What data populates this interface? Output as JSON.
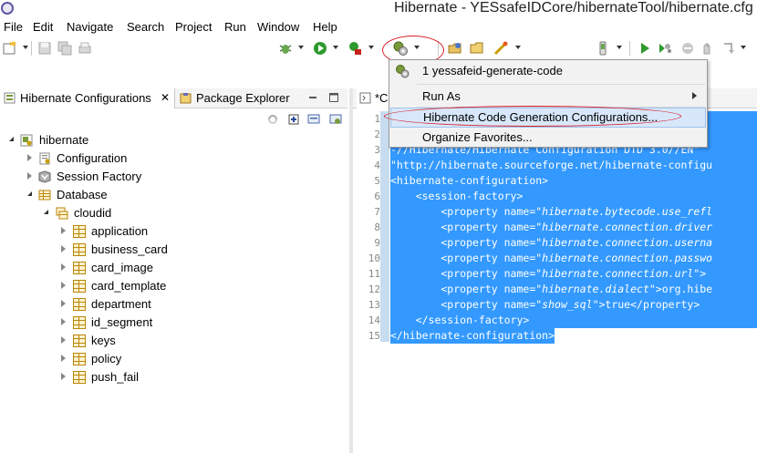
{
  "window": {
    "title": "Hibernate - YESsafeIDCore/hibernateTool/hibernate.cfg"
  },
  "menubar": [
    "File",
    "Edit",
    "Navigate",
    "Search",
    "Project",
    "Run",
    "Window",
    "Help"
  ],
  "left_view": {
    "tabs": [
      {
        "label": "Hibernate Configurations",
        "close": "✕"
      },
      {
        "label": "Package Explorer"
      }
    ],
    "tree": [
      {
        "label": "hibernate",
        "level": 0,
        "state": "open",
        "icon": "hibernate-config-icon"
      },
      {
        "label": "Configuration",
        "level": 1,
        "state": "closed",
        "icon": "configuration-icon"
      },
      {
        "label": "Session Factory",
        "level": 1,
        "state": "closed",
        "icon": "session-factory-icon"
      },
      {
        "label": "Database",
        "level": 1,
        "state": "open",
        "icon": "database-icon"
      },
      {
        "label": "cloudid",
        "level": 2,
        "state": "open",
        "icon": "schema-icon"
      },
      {
        "label": "application",
        "level": 3,
        "state": "closed",
        "icon": "table-icon"
      },
      {
        "label": "business_card",
        "level": 3,
        "state": "closed",
        "icon": "table-icon"
      },
      {
        "label": "card_image",
        "level": 3,
        "state": "closed",
        "icon": "table-icon"
      },
      {
        "label": "card_template",
        "level": 3,
        "state": "closed",
        "icon": "table-icon"
      },
      {
        "label": "department",
        "level": 3,
        "state": "closed",
        "icon": "table-icon"
      },
      {
        "label": "id_segment",
        "level": 3,
        "state": "closed",
        "icon": "table-icon"
      },
      {
        "label": "keys",
        "level": 3,
        "state": "closed",
        "icon": "table-icon"
      },
      {
        "label": "policy",
        "level": 3,
        "state": "closed",
        "icon": "table-icon"
      },
      {
        "label": "push_fail",
        "level": 3,
        "state": "closed",
        "icon": "table-icon"
      }
    ]
  },
  "editor": {
    "tab_label": "*Ca",
    "line_numbers": [
      "1",
      "2",
      "3",
      "4",
      "5",
      "6",
      "7",
      "8",
      "9",
      "10",
      "11",
      "12",
      "13",
      "14",
      "15"
    ],
    "lines": [
      {
        "n": "1",
        "segs": [
          {
            "t": ""
          }
        ]
      },
      {
        "n": "2",
        "segs": [
          {
            "t": ""
          }
        ]
      },
      {
        "n": "3",
        "segs": [
          {
            "t": "-//Hibernate/Hibernate Configuration DTD 3.0//EN\""
          }
        ]
      },
      {
        "n": "4",
        "segs": [
          {
            "t": "\"http://hibernate.sourceforge.net/hibernate-configu"
          }
        ]
      },
      {
        "n": "5",
        "segs": [
          {
            "t": "<hibernate-configuration>"
          }
        ]
      },
      {
        "n": "6",
        "segs": [
          {
            "t": "    <session-factory>"
          }
        ]
      },
      {
        "n": "7",
        "segs": [
          {
            "t": "        <property name=\""
          },
          {
            "t": "hibernate.bytecode.use_refl",
            "i": true
          }
        ]
      },
      {
        "n": "8",
        "segs": [
          {
            "t": "        <property name=\""
          },
          {
            "t": "hibernate.connection.driver",
            "i": true
          }
        ]
      },
      {
        "n": "9",
        "segs": [
          {
            "t": "        <property name=\""
          },
          {
            "t": "hibernate.connection.userna",
            "i": true
          }
        ]
      },
      {
        "n": "10",
        "segs": [
          {
            "t": "        <property name=\""
          },
          {
            "t": "hibernate.connection.passwo",
            "i": true
          }
        ]
      },
      {
        "n": "11",
        "segs": [
          {
            "t": "        <property name=\""
          },
          {
            "t": "hibernate.connection.url",
            "i": true
          },
          {
            "t": "\">"
          }
        ]
      },
      {
        "n": "12",
        "segs": [
          {
            "t": "        <property name=\""
          },
          {
            "t": "hibernate.dialect",
            "i": true
          },
          {
            "t": "\">org.hibe"
          }
        ]
      },
      {
        "n": "13",
        "segs": [
          {
            "t": "        <property name=\""
          },
          {
            "t": "show_sql",
            "i": true
          },
          {
            "t": "\">true</property>"
          }
        ]
      },
      {
        "n": "14",
        "segs": [
          {
            "t": "    </session-factory>"
          }
        ]
      },
      {
        "n": "15",
        "segs": [
          {
            "t": "</hibernate-configuration>"
          }
        ]
      }
    ],
    "selection_color": "#3399ff"
  },
  "popup_menu": {
    "items": [
      {
        "label": "1 yessafeid-generate-code",
        "icon": "hibernate-run-icon"
      },
      {
        "label": "Run As",
        "submenu": true
      },
      {
        "label": "Hibernate Code Generation Configurations...",
        "highlighted": true
      },
      {
        "label": "Organize Favorites..."
      }
    ]
  },
  "annotation_color": "#d81e28"
}
